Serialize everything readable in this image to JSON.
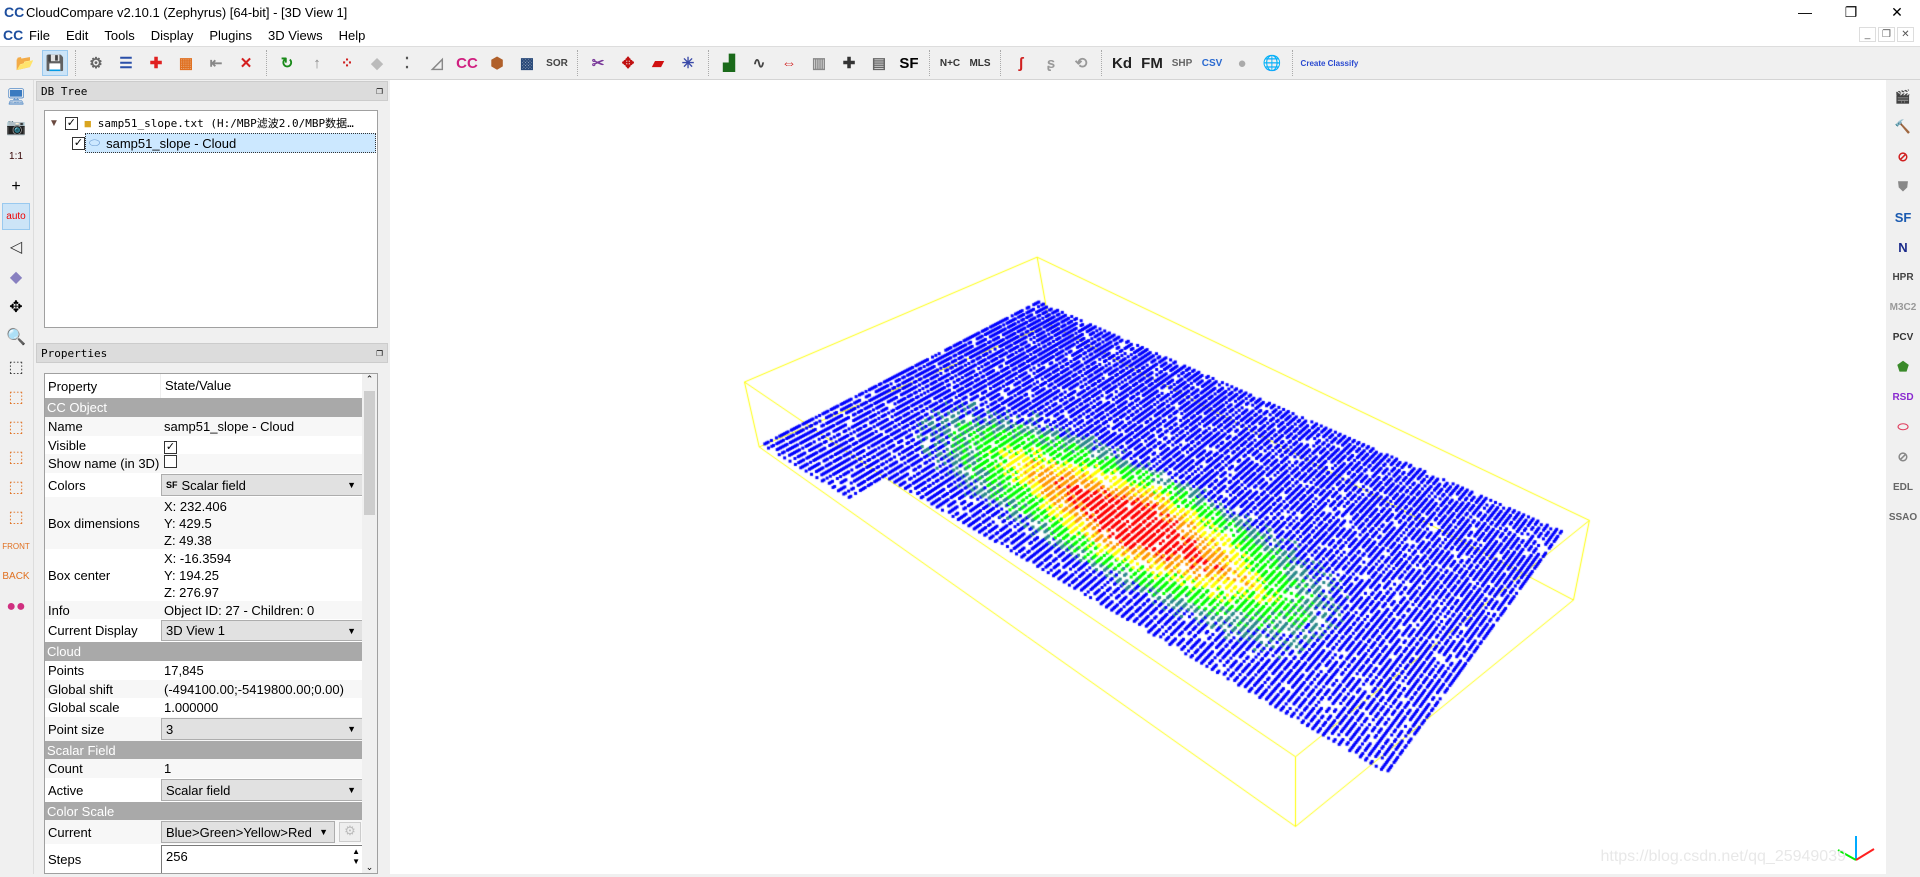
{
  "window": {
    "title": "CloudCompare v2.10.1 (Zephyrus) [64-bit] - [3D View 1]",
    "logo": "CC",
    "minimize": "—",
    "maximize": "❐",
    "close": "✕"
  },
  "menu": [
    "File",
    "Edit",
    "Tools",
    "Display",
    "Plugins",
    "3D Views",
    "Help"
  ],
  "mdi": {
    "minimize": "_",
    "restore": "❐",
    "close": "✕"
  },
  "toolbar": [
    {
      "name": "open-icon",
      "glyph": "📂",
      "color": "#3a6fb0"
    },
    {
      "name": "save-icon",
      "glyph": "💾",
      "color": "#555",
      "active": true
    },
    {
      "sep": true
    },
    {
      "name": "clone-icon",
      "glyph": "⚙",
      "color": "#666"
    },
    {
      "name": "properties-icon",
      "glyph": "☰",
      "color": "#2a4fa8"
    },
    {
      "name": "add-points-icon",
      "glyph": "✚",
      "color": "#e02020"
    },
    {
      "name": "colorize-icon",
      "glyph": "▦",
      "color": "#e07020"
    },
    {
      "name": "export-icon",
      "glyph": "⇤",
      "color": "#888"
    },
    {
      "name": "delete-icon",
      "glyph": "✕",
      "color": "#d42020"
    },
    {
      "sep": true
    },
    {
      "name": "register-icon",
      "glyph": "↻",
      "color": "#1a8a1a"
    },
    {
      "name": "normals-icon",
      "glyph": "↑",
      "color": "#888"
    },
    {
      "name": "sample-points-icon",
      "glyph": "⁘",
      "color": "#d02020"
    },
    {
      "name": "mesh-icon",
      "glyph": "◆",
      "color": "#bbb"
    },
    {
      "name": "subsample-icon",
      "glyph": "⁚",
      "color": "#555"
    },
    {
      "name": "delaunay-icon",
      "glyph": "◿",
      "color": "#888"
    },
    {
      "name": "cloud-compare-icon",
      "glyph": "CC",
      "color": "#d02080"
    },
    {
      "name": "mesh-to-cloud-icon",
      "glyph": "⬢",
      "color": "#b0602a"
    },
    {
      "name": "checkerboard-icon",
      "glyph": "▩",
      "color": "#2a4a7a"
    },
    {
      "name": "sor-filter-icon",
      "glyph": "SOR",
      "color": "#444"
    },
    {
      "sep": true
    },
    {
      "name": "scissors-icon",
      "glyph": "✂",
      "color": "#7a3a9a"
    },
    {
      "name": "translate-icon",
      "glyph": "✥",
      "color": "#c01010"
    },
    {
      "name": "section-icon",
      "glyph": "▰",
      "color": "#d01010"
    },
    {
      "name": "point-pick-icon",
      "glyph": "✳",
      "color": "#3a4aa8"
    },
    {
      "sep": true
    },
    {
      "name": "histogram-icon",
      "glyph": "▟",
      "color": "#1a6a1a"
    },
    {
      "name": "gaussian-icon",
      "glyph": "∿",
      "color": "#444"
    },
    {
      "name": "min-max-icon",
      "glyph": "⇔",
      "color": "#d02020"
    },
    {
      "name": "sf-delete-icon",
      "glyph": "▥",
      "color": "#888"
    },
    {
      "name": "add-sf-icon",
      "glyph": "✚",
      "color": "#333"
    },
    {
      "name": "calculator-icon",
      "glyph": "▤",
      "color": "#666"
    },
    {
      "name": "sf-color-scale-icon",
      "glyph": "SF",
      "color": "#000"
    },
    {
      "sep": true
    },
    {
      "name": "normal-compute-icon",
      "glyph": "N+C",
      "color": "#333"
    },
    {
      "name": "mls-icon",
      "glyph": "MLS",
      "color": "#333"
    },
    {
      "sep": true
    },
    {
      "name": "curve-icon",
      "glyph": "ʃ",
      "color": "#d02020"
    },
    {
      "name": "trace-icon",
      "glyph": "ʂ",
      "color": "#999"
    },
    {
      "name": "rotate-icon",
      "glyph": "⟲",
      "color": "#999"
    },
    {
      "sep": true
    },
    {
      "name": "kd-tree-icon",
      "glyph": "Kd",
      "color": "#222"
    },
    {
      "name": "fast-marching-icon",
      "glyph": "FM",
      "color": "#222"
    },
    {
      "name": "shp-file-icon",
      "glyph": "SHP",
      "color": "#666"
    },
    {
      "name": "csv-file-icon",
      "glyph": "CSV",
      "color": "#2a6ad0"
    },
    {
      "name": "sphere-icon",
      "glyph": "●",
      "color": "#aaa"
    },
    {
      "name": "globe-icon",
      "glyph": "🌐",
      "color": "#333"
    },
    {
      "sep": true
    },
    {
      "name": "canupo-create-icon",
      "glyph": "Create",
      "color": "#2a4ad0"
    },
    {
      "name": "canupo-classify-icon",
      "glyph": "Classify",
      "color": "#2a4ad0"
    }
  ],
  "left_toolbar": [
    {
      "name": "fullscreen-icon",
      "glyph": "🖥",
      "color": "#3a7ac0"
    },
    {
      "name": "camera-icon",
      "glyph": "📷",
      "color": "#334"
    },
    {
      "name": "zoom-1-1-icon",
      "glyph": "1:1",
      "color": "#300"
    },
    {
      "name": "pivot-icon",
      "glyph": "+",
      "color": "#000"
    },
    {
      "name": "pivot-auto-icon",
      "glyph": "auto",
      "color": "#e00",
      "active": true
    },
    {
      "name": "perspective-icon",
      "glyph": "◁",
      "color": "#333"
    },
    {
      "name": "view-cube-icon",
      "glyph": "◆",
      "color": "#8880c0"
    },
    {
      "name": "rotation-center-icon",
      "glyph": "✥",
      "color": "#000"
    },
    {
      "name": "zoom-icon",
      "glyph": "🔍",
      "color": "#3a7aa0"
    },
    {
      "name": "view-top-icon",
      "glyph": "⬚",
      "color": "#333"
    },
    {
      "name": "view-front-icon",
      "glyph": "⬚",
      "color": "#e07020"
    },
    {
      "name": "view-left-icon",
      "glyph": "⬚",
      "color": "#e07020"
    },
    {
      "name": "view-back-icon",
      "glyph": "⬚",
      "color": "#e07020"
    },
    {
      "name": "view-right-icon",
      "glyph": "⬚",
      "color": "#e07020"
    },
    {
      "name": "view-bottom-icon",
      "glyph": "⬚",
      "color": "#e07020"
    },
    {
      "name": "iso-front-icon",
      "glyph": "FRONT",
      "color": "#e07020"
    },
    {
      "name": "iso-back-icon",
      "glyph": "BACK",
      "color": "#e07020"
    },
    {
      "name": "stereo-icon",
      "glyph": "●●",
      "color": "#d03080"
    }
  ],
  "right_toolbar": [
    {
      "name": "animation-icon",
      "glyph": "🎬",
      "color": "#555"
    },
    {
      "name": "hammer-icon",
      "glyph": "🔨",
      "color": "#b07020"
    },
    {
      "name": "compass-icon",
      "glyph": "⊘",
      "color": "#d02020"
    },
    {
      "name": "shield-icon",
      "glyph": "⛊",
      "color": "#888"
    },
    {
      "name": "sf-plugin-icon",
      "glyph": "SF",
      "color": "#1a5ab0"
    },
    {
      "name": "north-icon",
      "glyph": "N",
      "color": "#1a2a8a"
    },
    {
      "name": "hpr-icon",
      "glyph": "HPR",
      "color": "#444"
    },
    {
      "name": "m3c2-icon",
      "glyph": "M3C2",
      "color": "#999"
    },
    {
      "name": "pcv-icon",
      "glyph": "PCV",
      "color": "#333"
    },
    {
      "name": "polygon-icon",
      "glyph": "⬟",
      "color": "#3a8a2a"
    },
    {
      "name": "rsd-icon",
      "glyph": "RSD",
      "color": "#8a2ad0"
    },
    {
      "name": "ellipse-icon",
      "glyph": "⬭",
      "color": "#e04060"
    },
    {
      "name": "disable-shader-icon",
      "glyph": "⊘",
      "color": "#888"
    },
    {
      "name": "edl-icon",
      "glyph": "EDL",
      "color": "#666"
    },
    {
      "name": "ssao-icon",
      "glyph": "SSAO",
      "color": "#666"
    }
  ],
  "db_tree": {
    "header": "DB Tree",
    "file_item": "samp51_slope.txt (H:/MBP滤波2.0/MBP数据…",
    "cloud_item": "samp51_slope - Cloud"
  },
  "properties": {
    "header": "Properties",
    "col_property": "Property",
    "col_value": "State/Value",
    "sections": {
      "cc_object": "CC Object",
      "cloud": "Cloud",
      "scalar_field": "Scalar Field",
      "color_scale": "Color Scale"
    },
    "name": {
      "label": "Name",
      "value": "samp51_slope - Cloud"
    },
    "visible": {
      "label": "Visible",
      "checked": true
    },
    "show_name": {
      "label": "Show name (in 3D)",
      "checked": false
    },
    "colors": {
      "label": "Colors",
      "value": "Scalar field"
    },
    "box_dimensions": {
      "label": "Box dimensions",
      "x": "X: 232.406",
      "y": "Y: 429.5",
      "z": "Z: 49.38"
    },
    "box_center": {
      "label": "Box center",
      "x": "X: -16.3594",
      "y": "Y: 194.25",
      "z": "Z: 276.97"
    },
    "info": {
      "label": "Info",
      "value": "Object ID: 27 - Children: 0"
    },
    "current_display": {
      "label": "Current Display",
      "value": "3D View 1"
    },
    "points": {
      "label": "Points",
      "value": "17,845"
    },
    "global_shift": {
      "label": "Global shift",
      "value": "(-494100.00;-5419800.00;0.00)"
    },
    "global_scale": {
      "label": "Global scale",
      "value": "1.000000"
    },
    "point_size": {
      "label": "Point size",
      "value": "3"
    },
    "count": {
      "label": "Count",
      "value": "1"
    },
    "active": {
      "label": "Active",
      "value": "Scalar field"
    },
    "current_scale": {
      "label": "Current",
      "value": "Blue>Green>Yellow>Red"
    },
    "steps": {
      "label": "Steps",
      "value": "256"
    }
  },
  "view": {
    "bbox_color": "#ffff00",
    "scale_colors": [
      "#0000ff",
      "#00ff00",
      "#ffff00",
      "#ff0000"
    ],
    "watermark": "https://blog.csdn.net/qq_25949039"
  }
}
